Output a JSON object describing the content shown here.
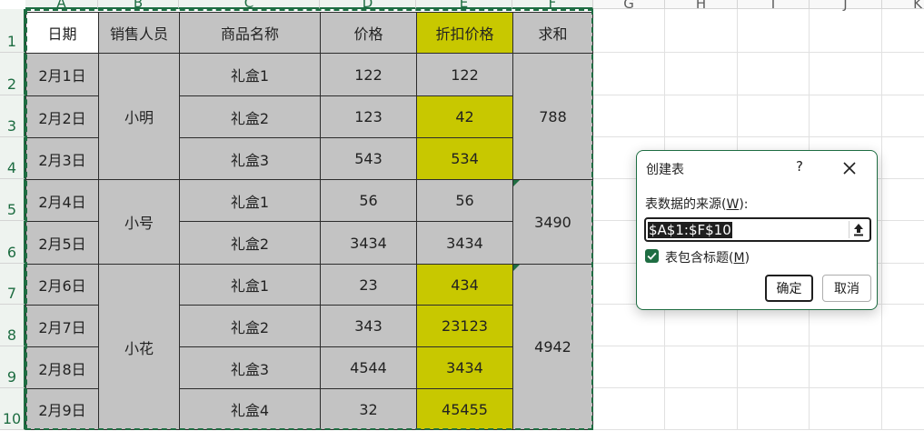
{
  "sheet": {
    "columns": [
      "A",
      "B",
      "C",
      "D",
      "E",
      "F",
      "G",
      "H",
      "I",
      "J",
      "K"
    ],
    "rows": [
      "1",
      "2",
      "3",
      "4",
      "5",
      "6",
      "7",
      "8",
      "9",
      "10"
    ],
    "headers": [
      "日期",
      "销售人员",
      "商品名称",
      "价格",
      "折扣价格",
      "求和"
    ],
    "dates": [
      "2月1日",
      "2月2日",
      "2月3日",
      "2月4日",
      "2月5日",
      "2月6日",
      "2月7日",
      "2月8日",
      "2月9日"
    ],
    "salespeople": [
      "小明",
      "小号",
      "小花"
    ],
    "products": [
      "礼盒1",
      "礼盒2",
      "礼盒3",
      "礼盒1",
      "礼盒2",
      "礼盒1",
      "礼盒2",
      "礼盒3",
      "礼盒4"
    ],
    "prices": [
      "122",
      "123",
      "543",
      "56",
      "3434",
      "23",
      "343",
      "4544",
      "32"
    ],
    "discount_prices": [
      "122",
      "42",
      "534",
      "56",
      "3434",
      "434",
      "23123",
      "3434",
      "45455"
    ],
    "sums": [
      "788",
      "3490",
      "4942"
    ]
  },
  "dialog": {
    "title": "创建表",
    "help": "?",
    "source_label_prefix": "表数据的来源(",
    "source_label_key": "W",
    "source_label_suffix": "):",
    "range_value": "$A$1:$F$10",
    "header_check_prefix": "表包含标题(",
    "header_check_key": "M",
    "header_check_suffix": ")",
    "header_checked": true,
    "ok_label": "确定",
    "cancel_label": "取消"
  },
  "colors": {
    "accent": "#1e6d42",
    "cell_gray": "#c3c3c3",
    "highlight_yellow": "#c8c800"
  }
}
